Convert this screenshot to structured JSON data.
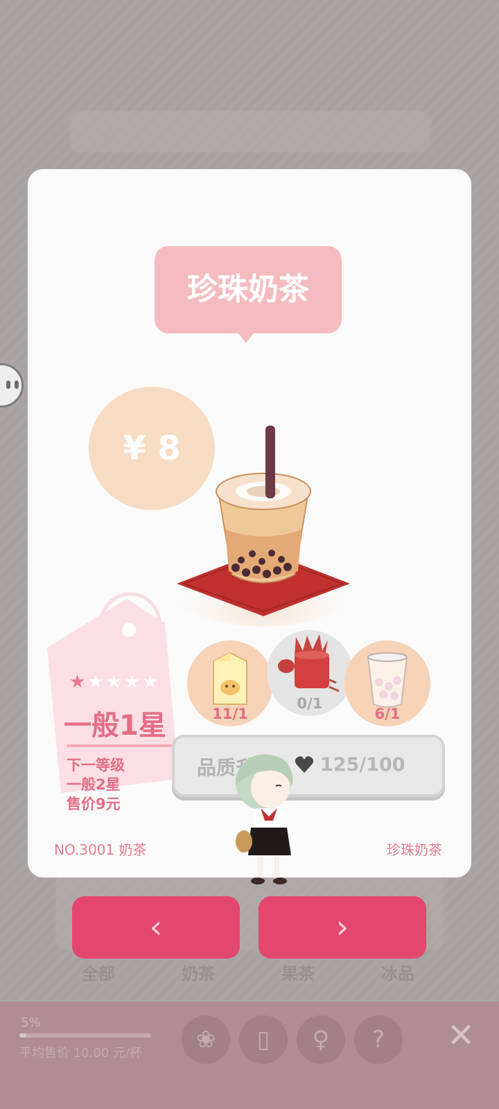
{
  "drink": {
    "name": "珍珠奶茶",
    "price": "¥ 8"
  },
  "level": {
    "stars_total": 5,
    "stars_filled": 1,
    "current": "一般1星",
    "next_label": "下一等级",
    "next_level": "一般2星",
    "next_price": "售价9元"
  },
  "ingredients": [
    {
      "icon": "milk-carton-icon",
      "count": "11/1"
    },
    {
      "icon": "tea-tin-icon",
      "count": "0/1"
    },
    {
      "icon": "pearl-cup-icon",
      "count": "6/1"
    }
  ],
  "upgrade": {
    "label": "品质升级",
    "heart_icon": "heart-icon",
    "hearts": "125/100"
  },
  "footer": {
    "number": "NO.3001 奶茶",
    "name": "珍珠奶茶"
  },
  "nav": {
    "prev": "‹",
    "next": "›"
  },
  "background": {
    "tabs": [
      "全部",
      "奶茶",
      "果茶",
      "冰品"
    ],
    "progress_percent": "5%",
    "progress_value": 0.05,
    "avg_price": "平均售价 10.00 元/杯",
    "tools": [
      "apple-icon",
      "cup-icon",
      "person-icon",
      "question-icon"
    ],
    "close_icon": "close-icon"
  },
  "colors": {
    "accent": "#e4476e",
    "title_bubble": "#f4bcbf",
    "price_circle": "#f7dcc3",
    "tag_text": "#e36e85"
  }
}
